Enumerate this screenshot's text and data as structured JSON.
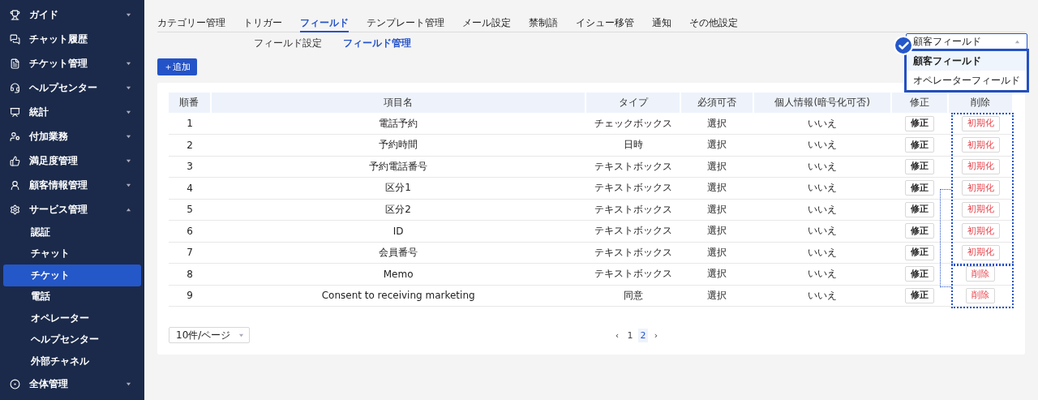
{
  "sidebar": {
    "items": [
      {
        "label": "ガイド",
        "expanded": false
      },
      {
        "label": "チャット履歴"
      },
      {
        "label": "チケット管理",
        "expanded": false
      },
      {
        "label": "ヘルプセンター",
        "expanded": false
      },
      {
        "label": "統計",
        "expanded": false
      },
      {
        "label": "付加業務",
        "expanded": false
      },
      {
        "label": "満足度管理",
        "expanded": false
      },
      {
        "label": "顧客情報管理",
        "expanded": false
      },
      {
        "label": "サービス管理",
        "expanded": true,
        "children": [
          {
            "label": "認証",
            "selected": false
          },
          {
            "label": "チャット",
            "selected": false
          },
          {
            "label": "チケット",
            "selected": true
          },
          {
            "label": "電話",
            "selected": false
          },
          {
            "label": "オペレーター",
            "selected": false
          },
          {
            "label": "ヘルプセンター",
            "selected": false
          },
          {
            "label": "外部チャネル",
            "selected": false
          }
        ]
      },
      {
        "label": "全体管理",
        "expanded": false
      }
    ]
  },
  "tabs": [
    {
      "label": "カテゴリー管理",
      "selected": false
    },
    {
      "label": "トリガー",
      "selected": false
    },
    {
      "label": "フィールド",
      "selected": true
    },
    {
      "label": "テンプレート管理",
      "selected": false
    },
    {
      "label": "メール設定",
      "selected": false
    },
    {
      "label": "禁制語",
      "selected": false
    },
    {
      "label": "イシュー移管",
      "selected": false
    },
    {
      "label": "通知",
      "selected": false
    },
    {
      "label": "その他設定",
      "selected": false
    }
  ],
  "subtabs": [
    {
      "label": "フィールド設定",
      "selected": false
    },
    {
      "label": "フィールド管理",
      "selected": true
    }
  ],
  "add_button": "＋追加",
  "field_type_select": {
    "value": "顧客フィールド",
    "open": true,
    "options": [
      {
        "label": "顧客フィールド",
        "selected": true
      },
      {
        "label": "オペレーターフィールド",
        "selected": false
      }
    ]
  },
  "table": {
    "columns": [
      "順番",
      "項目名",
      "タイプ",
      "必須可否",
      "個人情報(暗号化可否)",
      "修正",
      "削除"
    ],
    "rows": [
      {
        "no": "1",
        "name": "電話予約",
        "type": "チェックボックス",
        "required": "選択",
        "personal": "いいえ",
        "edit": "修正",
        "action": "初期化"
      },
      {
        "no": "2",
        "name": "予約時間",
        "type": "日時",
        "required": "選択",
        "personal": "いいえ",
        "edit": "修正",
        "action": "初期化"
      },
      {
        "no": "3",
        "name": "予約電話番号",
        "type": "テキストボックス",
        "required": "選択",
        "personal": "いいえ",
        "edit": "修正",
        "action": "初期化"
      },
      {
        "no": "4",
        "name": "区分1",
        "type": "テキストボックス",
        "required": "選択",
        "personal": "いいえ",
        "edit": "修正",
        "action": "初期化"
      },
      {
        "no": "5",
        "name": "区分2",
        "type": "テキストボックス",
        "required": "選択",
        "personal": "いいえ",
        "edit": "修正",
        "action": "初期化"
      },
      {
        "no": "6",
        "name": "ID",
        "type": "テキストボックス",
        "required": "選択",
        "personal": "いいえ",
        "edit": "修正",
        "action": "初期化"
      },
      {
        "no": "7",
        "name": "会員番号",
        "type": "テキストボックス",
        "required": "選択",
        "personal": "いいえ",
        "edit": "修正",
        "action": "初期化"
      },
      {
        "no": "8",
        "name": "Memo",
        "type": "テキストボックス",
        "required": "選択",
        "personal": "いいえ",
        "edit": "修正",
        "action": "削除"
      },
      {
        "no": "9",
        "name": "Consent to receiving marketing",
        "type": "同意",
        "required": "選択",
        "personal": "いいえ",
        "edit": "修正",
        "action": "削除"
      }
    ]
  },
  "page_size": "10件/ページ",
  "pagination": {
    "prev": "‹",
    "next": "›",
    "pages": [
      {
        "label": "1",
        "selected": false
      },
      {
        "label": "2",
        "selected": true
      }
    ]
  }
}
